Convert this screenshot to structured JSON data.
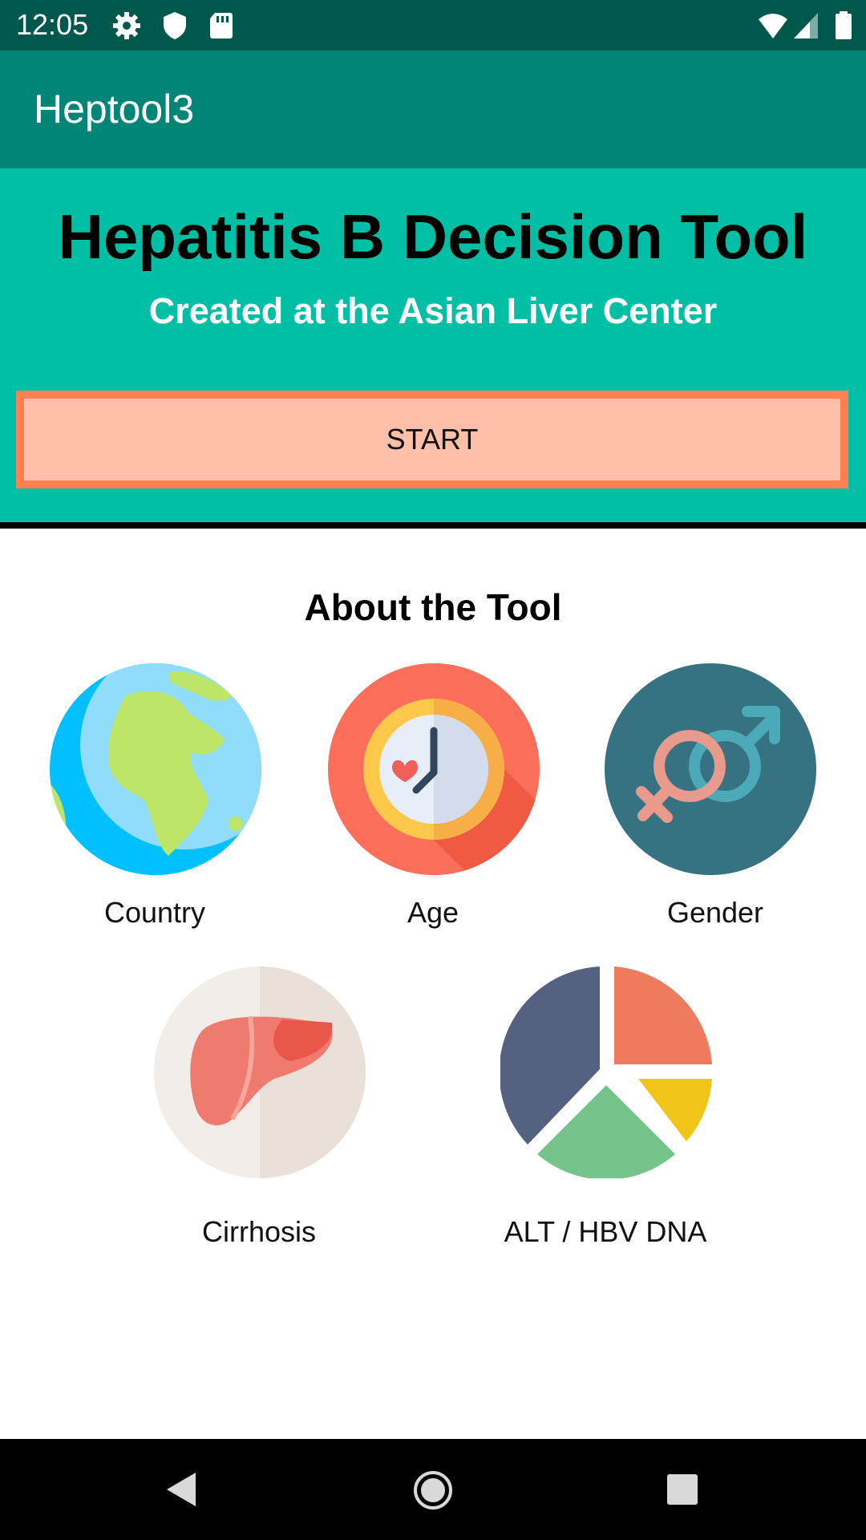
{
  "status_bar": {
    "time": "12:05",
    "icons": [
      "gear-icon",
      "shield-icon",
      "sd-card-icon",
      "wifi-icon",
      "signal-icon",
      "battery-icon"
    ]
  },
  "app_bar": {
    "title": "Heptool3"
  },
  "hero": {
    "title": "Hepatitis B Decision Tool",
    "subtitle": "Created at the Asian Liver Center",
    "start_label": "START"
  },
  "about": {
    "title": "About the Tool",
    "items": [
      {
        "label": "Country",
        "icon": "globe-icon"
      },
      {
        "label": "Age",
        "icon": "clock-icon"
      },
      {
        "label": "Gender",
        "icon": "gender-icon"
      },
      {
        "label": "Cirrhosis",
        "icon": "liver-icon"
      },
      {
        "label": "ALT / HBV DNA",
        "icon": "pie-chart-icon"
      }
    ]
  },
  "nav_bar": {
    "icons": [
      "back-icon",
      "home-icon",
      "recents-icon"
    ]
  },
  "colors": {
    "status_bar": "#00574b",
    "app_bar": "#008577",
    "hero_bg": "#00bfa5",
    "start_border": "#ff7f50",
    "start_fill": "#ffbfa8"
  }
}
